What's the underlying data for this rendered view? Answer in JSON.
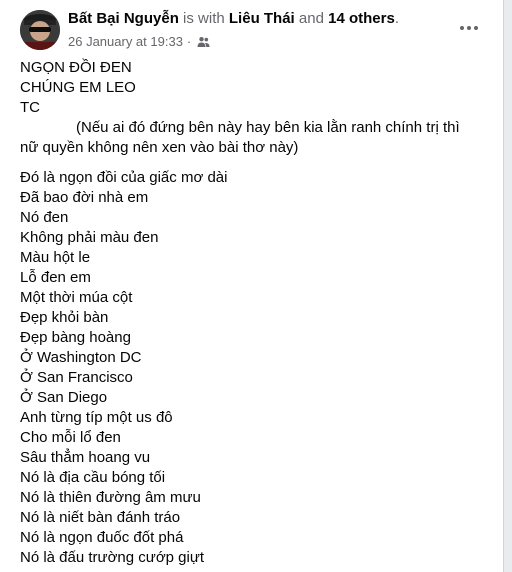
{
  "post": {
    "author": "Bất Bại Nguyễn",
    "with_text": "is with",
    "tagged_person": "Liêu Thái",
    "and_text": "and",
    "others": "14 others",
    "period": ".",
    "timestamp": "26 January at 19:33",
    "separator": "·",
    "audience_icon": "friends-icon",
    "more_icon": "more-options-icon",
    "title_lines": [
      "NGỌN ĐỒI ĐEN",
      "CHÚNG EM LEO",
      "TC"
    ],
    "note_first": "(Nếu ai đó đứng bên này hay   bên kia lằn ranh chính trị thì",
    "note_second": "nữ quyền không nên xen vào bài thơ này)",
    "poem_lines": [
      "Đó là ngọn đồi của giấc mơ dài",
      "Đã bao đời nhà em",
      "Nó đen",
      "Không phải màu đen",
      "Màu hột le",
      "Lỗ đen em",
      "Một thời múa cột",
      "Đẹp khỏi bàn",
      "Đẹp bàng hoàng",
      "Ở Washington DC",
      "Ở San Francisco",
      "Ở San Diego",
      "Anh từng típ một us đô",
      "Cho mỗi lổ đen",
      "Sâu thẳm hoang vu",
      "Nó là địa cầu bóng tối",
      "Nó là thiên đường âm mưu",
      "Nó là niết bàn đánh tráo",
      "Nó là ngọn đuốc đốt phá",
      "Nó là đấu trường cướp giựt"
    ]
  }
}
